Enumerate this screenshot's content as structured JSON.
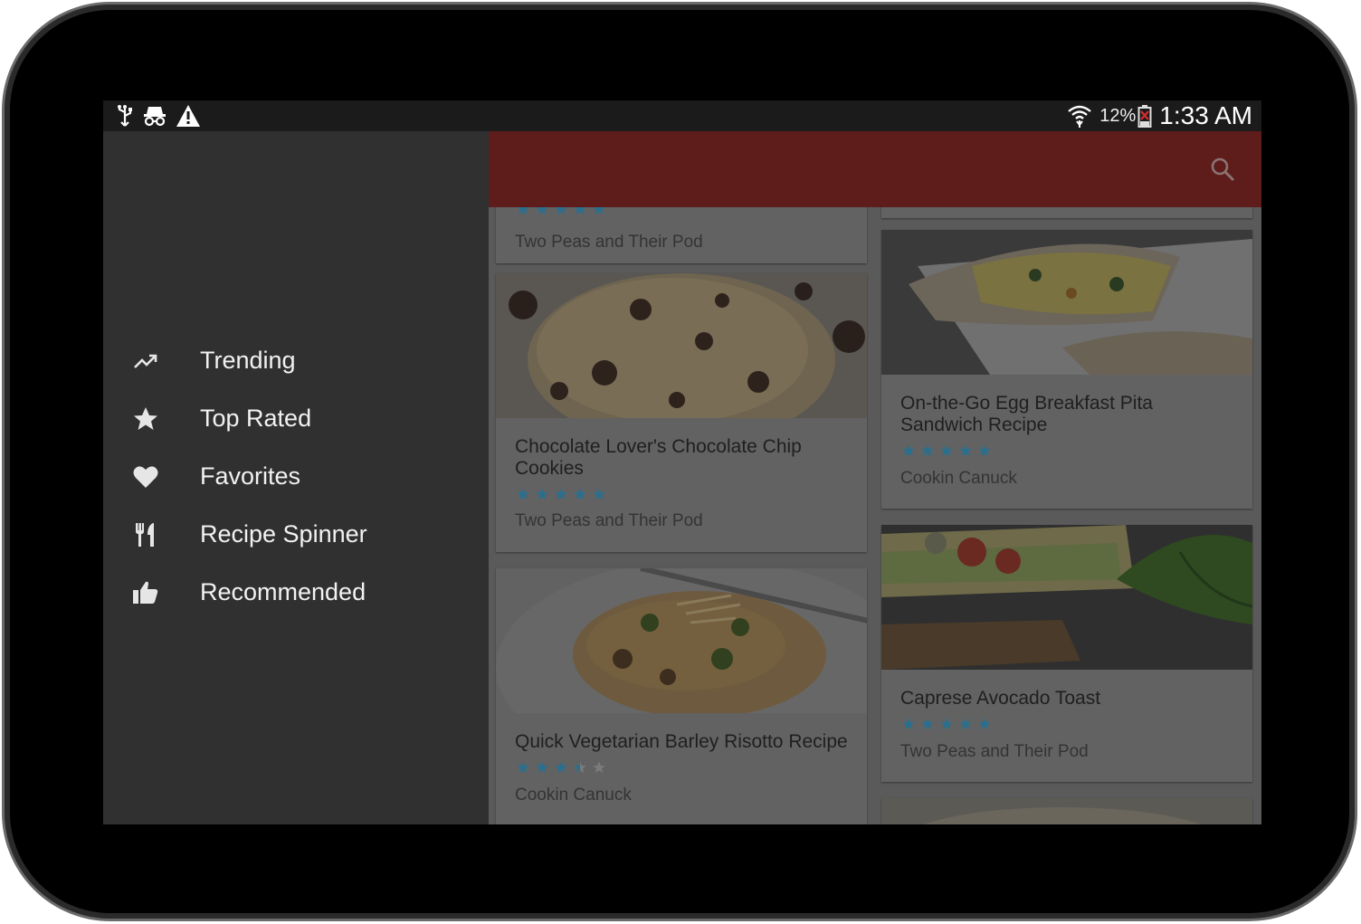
{
  "status_bar": {
    "left_icons": [
      "usb-icon",
      "incognito-icon",
      "warning-icon"
    ],
    "battery_percent": "12%",
    "time": "1:33 AM",
    "right_icons": [
      "wifi-icon",
      "battery-icon"
    ]
  },
  "app_bar": {
    "color": "#5e1c1a",
    "search_icon": "search-icon"
  },
  "drawer": {
    "items": [
      {
        "label": "Trending",
        "icon": "trending-icon"
      },
      {
        "label": "Top Rated",
        "icon": "star-icon"
      },
      {
        "label": "Favorites",
        "icon": "heart-icon"
      },
      {
        "label": "Recipe Spinner",
        "icon": "fork-knife-icon"
      },
      {
        "label": "Recommended",
        "icon": "thumbs-up-icon"
      }
    ]
  },
  "recipes": [
    {
      "title": "",
      "rating": 5,
      "source": "Two Peas and Their Pod",
      "image": "partial-card-top"
    },
    {
      "title": "Chocolate Lover's Chocolate Chip Cookies",
      "rating": 5,
      "source": "Two Peas and Their Pod",
      "image": "chocolate-chip-cookies-photo"
    },
    {
      "title": "Quick Vegetarian Barley Risotto Recipe",
      "rating": 3.5,
      "source": "Cookin Canuck",
      "image": "barley-risotto-photo"
    },
    {
      "title": "On-the-Go Egg Breakfast Pita Sandwich Recipe",
      "rating": 5,
      "source": "Cookin Canuck",
      "image": "egg-pita-sandwich-photo"
    },
    {
      "title": "Caprese Avocado Toast",
      "rating": 5,
      "source": "Two Peas and Their Pod",
      "image": "caprese-avocado-toast-photo"
    }
  ],
  "colors": {
    "star_filled": "#2b6f8d",
    "star_empty": "#7a7a7a",
    "drawer_bg": "#303030",
    "scrim": "#5a5a5a"
  }
}
